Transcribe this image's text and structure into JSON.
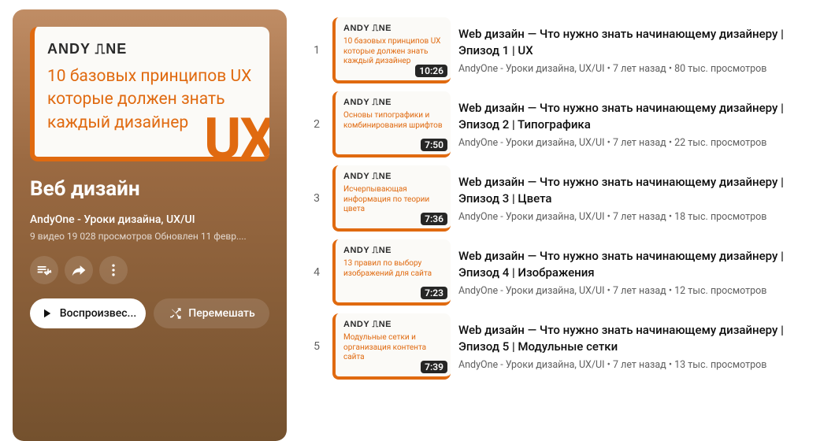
{
  "playlist": {
    "hero_logo": "ANDY ⎍NE",
    "hero_text": "10 базовых принципов UX которые должен знать каждый дизайнер",
    "hero_badge": "UX",
    "title": "Веб дизайн",
    "channel": "AndyOne - Уроки дизайна, UX/UI",
    "stats": "9 видео  19 028 просмотров  Обновлен 11 февр....",
    "play_label": "Воспроизвес...",
    "shuffle_label": "Перемешать"
  },
  "videos": [
    {
      "index": "1",
      "thumb_logo": "ANDY ⎍NE",
      "thumb_text": "10 базовых принципов UX которые должен знать каждый дизайнер",
      "duration": "10:26",
      "title": "Web дизайн — Что нужно знать начинающему дизайнеру | Эпизод 1 | UX",
      "channel": "AndyOne - Уроки дизайна, UX/UI",
      "age": "7 лет назад",
      "views": "80 тыс. просмотров"
    },
    {
      "index": "2",
      "thumb_logo": "ANDY ⎍NE",
      "thumb_text": "Основы типографики и комбинирования шрифтов",
      "duration": "7:50",
      "title": "Web дизайн — Что нужно знать начинающему дизайнеру | Эпизод 2 | Типографика",
      "channel": "AndyOne - Уроки дизайна, UX/UI",
      "age": "7 лет назад",
      "views": "22 тыс. просмотров"
    },
    {
      "index": "3",
      "thumb_logo": "ANDY ⎍NE",
      "thumb_text": "Исчерпывающая информация по теории цвета",
      "duration": "7:36",
      "title": "Web дизайн — Что нужно знать начинающему дизайнеру | Эпизод 3 | Цвета",
      "channel": "AndyOne - Уроки дизайна, UX/UI",
      "age": "7 лет назад",
      "views": "18 тыс. просмотров"
    },
    {
      "index": "4",
      "thumb_logo": "ANDY ⎍NE",
      "thumb_text": "13 правил по выбору изображений для сайта",
      "duration": "7:23",
      "title": "Web дизайн — Что нужно знать начинающему дизайнеру | Эпизод 4 | Изображения",
      "channel": "AndyOne - Уроки дизайна, UX/UI",
      "age": "7 лет назад",
      "views": "12 тыс. просмотров"
    },
    {
      "index": "5",
      "thumb_logo": "ANDY ⎍NE",
      "thumb_text": "Модульные сетки и организация контента сайта",
      "duration": "7:39",
      "title": "Web дизайн — Что нужно знать начинающему дизайнеру | Эпизод 5 | Модульные сетки",
      "channel": "AndyOne - Уроки дизайна, UX/UI",
      "age": "7 лет назад",
      "views": "13 тыс. просмотров"
    }
  ]
}
